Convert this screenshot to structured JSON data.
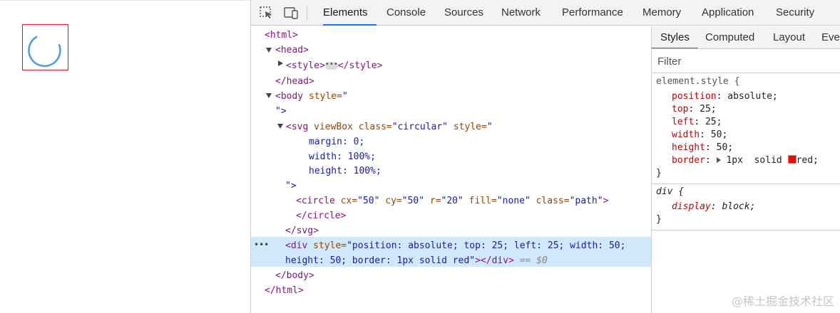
{
  "devtools": {
    "tabs": [
      "Elements",
      "Console",
      "Sources",
      "Network",
      "Performance",
      "Memory",
      "Application",
      "Security"
    ],
    "active_tab": "Elements",
    "tool_icons": [
      "inspect-element-icon",
      "device-toolbar-icon"
    ]
  },
  "dom": {
    "l1": "<html>",
    "l2": "<head>",
    "l3a": "<style>",
    "l3b": "</style>",
    "l4": "</head>",
    "l5_tag": "<body",
    "l5_attr": " style=",
    "l5_val": "\"",
    "l6_val": "\">",
    "l7_tag": "<svg",
    "l7_attr1": " viewBox",
    "l7_attr2": " class=",
    "l7_val2": "\"circular\"",
    "l7_attr3": " style=",
    "l7_val3": "\"",
    "l8": "margin: 0;",
    "l9": "width: 100%;",
    "l10": "height: 100%;",
    "l11": "\">",
    "l12_tag": "<circle",
    "l12_a1": " cx=",
    "l12_v1": "\"50\"",
    "l12_a2": " cy=",
    "l12_v2": "\"50\"",
    "l12_a3": " r=",
    "l12_v3": "\"20\"",
    "l12_a4": " fill=",
    "l12_v4": "\"none\"",
    "l12_a5": " class=",
    "l12_v5": "\"path\"",
    "l12_end": ">",
    "l13": "</circle>",
    "l14": "</svg>",
    "l15_tag": "<div",
    "l15_attr": " style=",
    "l15_val": "\"position: absolute; top: 25; left: 25; width: 50;",
    "l16_val": "height: 50; border: 1px solid red\"",
    "l16_tag": "></div>",
    "l16_dollar": " == $0",
    "l17": "</body>",
    "l18": "</html>",
    "selection_dots": "•••",
    "collapsed_chip": "•••"
  },
  "styles": {
    "tabs": [
      "Styles",
      "Computed",
      "Layout",
      "Event Listeners"
    ],
    "active_tab": "Styles",
    "filter_placeholder": "Filter",
    "rule1_selector": "element.style {",
    "rule1_props": [
      {
        "name": "position",
        "value": "absolute;"
      },
      {
        "name": "top",
        "value": "25;"
      },
      {
        "name": "left",
        "value": "25;"
      },
      {
        "name": "width",
        "value": "50;"
      },
      {
        "name": "height",
        "value": "50;"
      },
      {
        "name": "border",
        "value": "1px  solid"
      },
      {
        "name": "border_color",
        "value": "red;"
      }
    ],
    "rule1_close": "}",
    "rule2_selector": "div {",
    "rule2_prop": "display",
    "rule2_value": "block;",
    "rule2_close": "}"
  },
  "watermark": "@稀土掘金技术社区",
  "colors": {
    "accent": "#1a73e8",
    "selection": "#cfe8fc",
    "spinner": "#4a9be0",
    "highlight_border": "#ee1111"
  }
}
